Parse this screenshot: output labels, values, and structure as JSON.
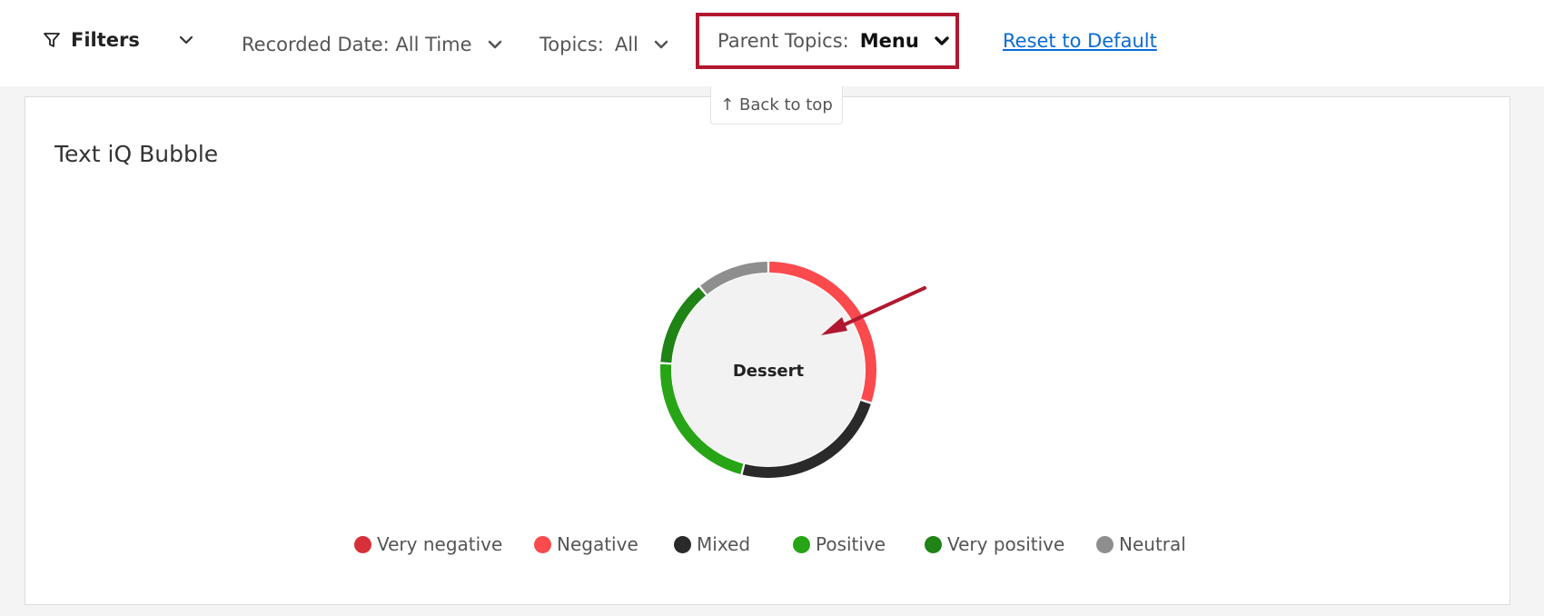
{
  "toolbar": {
    "filters_label": "Filters",
    "recorded_date_label": "Recorded Date: All Time",
    "topics_label": "Topics:",
    "topics_value": "All",
    "parent_topics_label": "Parent Topics:",
    "parent_topics_value": "Menu",
    "reset_label": "Reset to Default"
  },
  "back_to_top_label": "↑ Back to top",
  "widget": {
    "title": "Text iQ Bubble",
    "bubble_label": "Dessert"
  },
  "legend": [
    {
      "label": "Very negative",
      "color": "#d7303a"
    },
    {
      "label": "Negative",
      "color": "#fb4a4d"
    },
    {
      "label": "Mixed",
      "color": "#2a2a2a"
    },
    {
      "label": "Positive",
      "color": "#27a516"
    },
    {
      "label": "Very positive",
      "color": "#1f8315"
    },
    {
      "label": "Neutral",
      "color": "#8e8e8e"
    }
  ],
  "bubble_segments": [
    {
      "sentiment": "Negative",
      "fraction": 0.3,
      "color": "#fb4a4d"
    },
    {
      "sentiment": "Mixed",
      "fraction": 0.24,
      "color": "#2a2a2a"
    },
    {
      "sentiment": "Positive",
      "fraction": 0.22,
      "color": "#27a516"
    },
    {
      "sentiment": "Very positive",
      "fraction": 0.13,
      "color": "#1f8315"
    },
    {
      "sentiment": "Neutral",
      "fraction": 0.11,
      "color": "#8e8e8e"
    }
  ],
  "colors": {
    "highlight_box": "#b1182f",
    "annotation_arrow": "#b1182f",
    "link": "#0b6bd4"
  }
}
